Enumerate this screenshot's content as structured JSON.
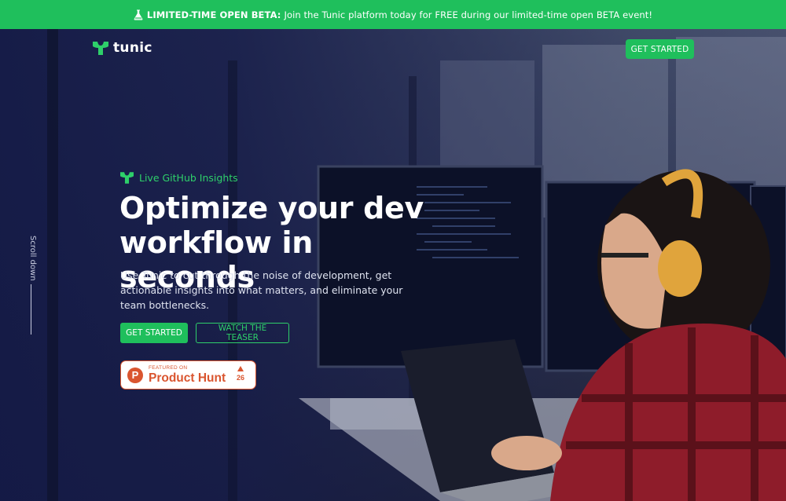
{
  "announcement": {
    "icon": "flask-icon",
    "bold": "LIMITED-TIME OPEN BETA:",
    "text": "Join the Tunic platform today for FREE during our limited-time open BETA event!"
  },
  "nav": {
    "logo_text": "tunic",
    "cta_label": "GET STARTED"
  },
  "scroll_hint": "Scroll down",
  "hero": {
    "eyebrow": "Live GitHub Insights",
    "headline_line1": "Optimize your dev",
    "headline_line2": "workflow in seconds",
    "subcopy": "Use Tunic to cut through the noise of development, get actionable insights into what matters, and eliminate your team bottlenecks.",
    "primary_cta": "GET STARTED",
    "secondary_cta": "WATCH THE TEASER"
  },
  "product_hunt": {
    "featured_on": "FEATURED ON",
    "name": "Product Hunt",
    "logo_letter": "P",
    "votes": "26"
  },
  "colors": {
    "brand_green": "#1fbf5c",
    "accent_green": "#2ed06a",
    "hero_overlay": "#141a46",
    "product_hunt": "#da552f"
  }
}
